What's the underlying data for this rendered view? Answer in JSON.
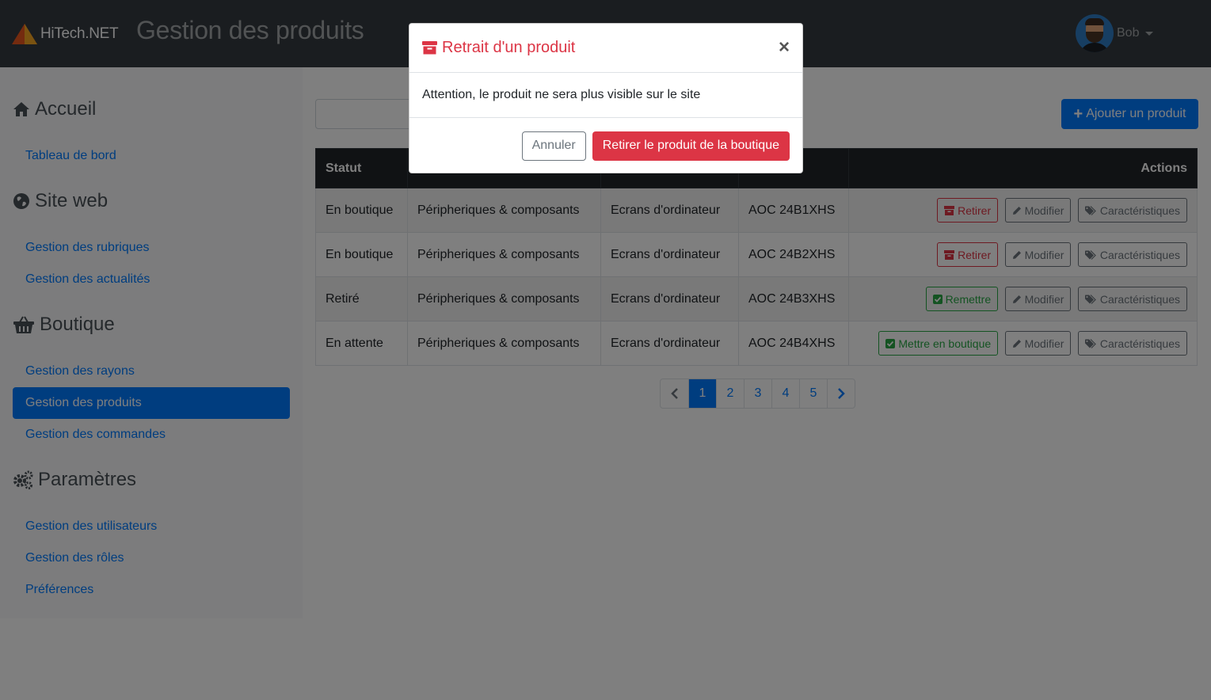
{
  "navbar": {
    "brand_name": "HiTech.NET",
    "page_title": "Gestion des produits",
    "user_name": "Bob"
  },
  "sidebar": {
    "sections": [
      {
        "heading": "Accueil",
        "icon": "home-icon",
        "links": [
          {
            "label": "Tableau de bord",
            "active": false
          }
        ]
      },
      {
        "heading": "Site web",
        "icon": "globe-icon",
        "links": [
          {
            "label": "Gestion des rubriques",
            "active": false
          },
          {
            "label": "Gestion des actualités",
            "active": false
          }
        ]
      },
      {
        "heading": "Boutique",
        "icon": "basket-icon",
        "links": [
          {
            "label": "Gestion des rayons",
            "active": false
          },
          {
            "label": "Gestion des produits",
            "active": true
          },
          {
            "label": "Gestion des commandes",
            "active": false
          }
        ]
      },
      {
        "heading": "Paramètres",
        "icon": "cogs-icon",
        "links": [
          {
            "label": "Gestion des utilisateurs",
            "active": false
          },
          {
            "label": "Gestion des rôles",
            "active": false
          },
          {
            "label": "Préférences",
            "active": false
          }
        ]
      }
    ]
  },
  "toolbar": {
    "add_label": "Ajouter un produit"
  },
  "table": {
    "headers": [
      "Statut",
      "",
      "",
      "",
      "Actions"
    ],
    "rows": [
      {
        "status": "En boutique",
        "status_color": "#28a745",
        "category": "Péripheriques & composants",
        "section": "Ecrans d'ordinateur",
        "name": "AOC 24B1XHS",
        "action": "Retirer"
      },
      {
        "status": "En boutique",
        "status_color": "#28a745",
        "category": "Péripheriques & composants",
        "section": "Ecrans d'ordinateur",
        "name": "AOC 24B2XHS",
        "action": "Retirer"
      },
      {
        "status": "Retiré",
        "status_color": "#dc3545",
        "category": "Péripheriques & composants",
        "section": "Ecrans d'ordinateur",
        "name": "AOC 24B3XHS",
        "action": "Remettre"
      },
      {
        "status": "En attente",
        "status_color": "#6c757d",
        "category": "Péripheriques & composants",
        "section": "Ecrans d'ordinateur",
        "name": "AOC 24B4XHS",
        "action": "Mettre en boutique"
      }
    ],
    "modify_label": "Modifier",
    "specs_label": "Caractéristiques"
  },
  "pagination": {
    "pages": [
      "1",
      "2",
      "3",
      "4",
      "5"
    ],
    "current": "1"
  },
  "modal": {
    "title": "Retrait d'un produit",
    "close": "×",
    "body": "Attention, le produit ne sera plus visible sur le site",
    "cancel_label": "Annuler",
    "confirm_label": "Retirer le produit de la boutique"
  },
  "colors": {
    "primary": "#007bff",
    "danger": "#dc3545",
    "success": "#28a745",
    "navbar": "#343a40"
  }
}
